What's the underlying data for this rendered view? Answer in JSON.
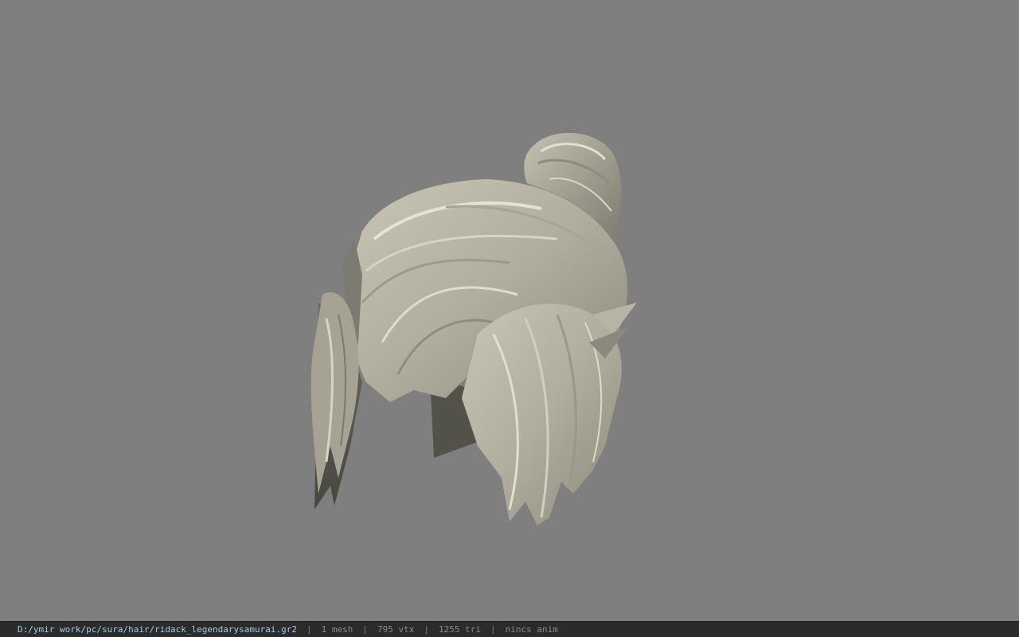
{
  "viewport": {
    "background_color": "#7f7f7f",
    "model_icon": "hair-mesh-render"
  },
  "statusbar": {
    "file_path": "D:/ymir work/pc/sura/hair/ridack_legendarysamurai.gr2",
    "separator": "|",
    "mesh_count": "1 mesh",
    "vertex_count": "795 vtx",
    "triangle_count": "1255 tri",
    "anim_status": "nincs anim",
    "path_color": "#9ecfe6",
    "text_color": "#8a8a8a",
    "background_color": "#2b2b2b"
  }
}
